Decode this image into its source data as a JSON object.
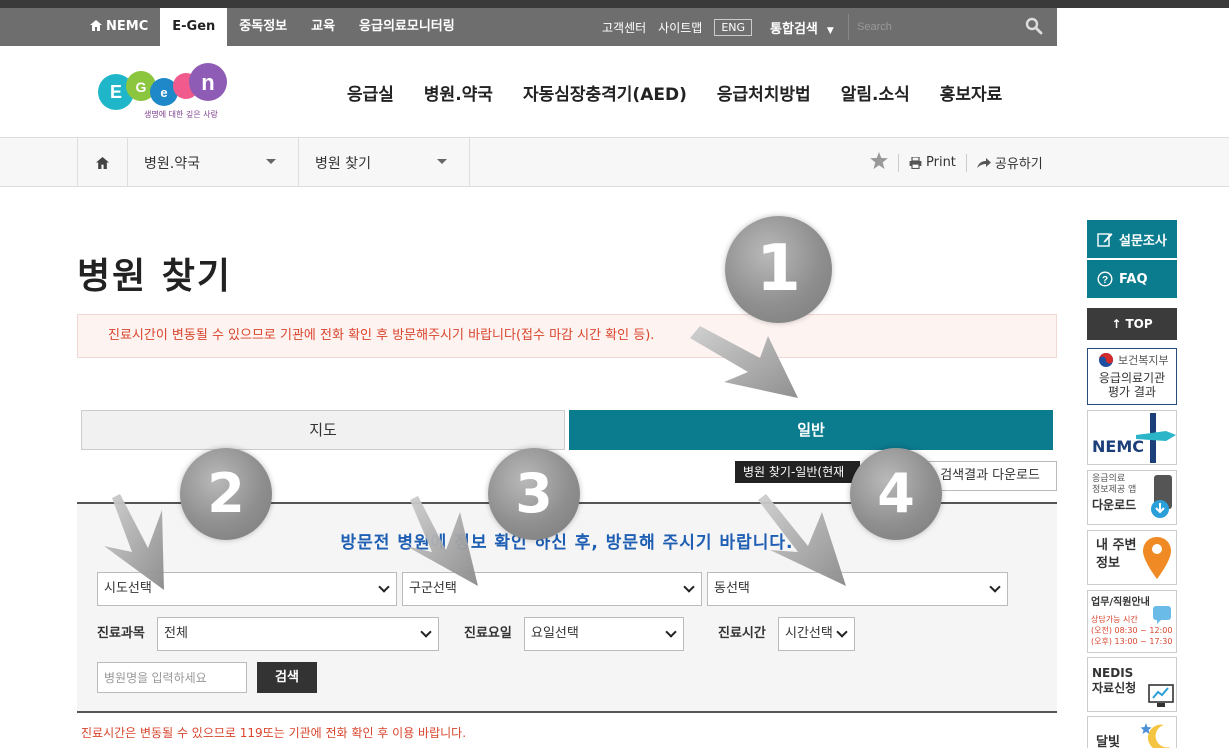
{
  "topnav": {
    "items": [
      {
        "label": "NEMC",
        "active": false
      },
      {
        "label": "E-Gen",
        "active": true
      },
      {
        "label": "중독정보",
        "active": false
      },
      {
        "label": "교육",
        "active": false
      },
      {
        "label": "응급의료모니터링",
        "active": false
      }
    ]
  },
  "toputil": {
    "customer_center": "고객센터",
    "sitemap": "사이트맵",
    "eng": "ENG",
    "total_search": "통합검색",
    "search_placeholder": "Search"
  },
  "logo": {
    "tagline": "생명에 대한 깊은 사랑"
  },
  "mainnav": {
    "items": [
      "응급실",
      "병원.약국",
      "자동심장충격기(AED)",
      "응급처치방법",
      "알림.소식",
      "홍보자료"
    ]
  },
  "breadcrumb": {
    "level1": "병원.약국",
    "level2": "병원 찾기",
    "print": "Print",
    "share": "공유하기"
  },
  "page": {
    "title": "병원 찾기",
    "notice": "진료시간이 변동될 수 있으므로 기관에 전화 확인 후 방문해주시기 바랍니다(접수 마감 시간 확인 등).",
    "tab_map": "지도",
    "tab_general": "일반",
    "tooltip": "병원 찾기-일반(현재",
    "download": "검색결과 다운로드",
    "bottom_note": "진료시간은 변동될 수 있으므로 119또는 기관에 전화 확인 후 이용 바랍니다."
  },
  "search": {
    "title": "방문전 병원에 정보 확인 하신 후, 방문해 주시기 바랍니다.",
    "sido": "시도선택",
    "gugun": "구군선택",
    "dong": "동선택",
    "dept_label": "진료과목",
    "dept_value": "전체",
    "day_label": "진료요일",
    "day_value": "요일선택",
    "time_label": "진료시간",
    "time_value": "시간선택",
    "name_placeholder": "병원명을 입력하세요",
    "search_button": "검색"
  },
  "quickbar": {
    "survey": "설문조사",
    "faq": "FAQ",
    "top": "TOP",
    "mohw": "보건복지부",
    "eval_line1": "응급의료기관",
    "eval_line2": "평가 결과",
    "nemc": "NEMC",
    "app_line1": "응급의료",
    "app_line2": "정보제공 앱",
    "app_line3": "다운로드",
    "near_line1": "내 주변",
    "near_line2": "정보",
    "staff_title": "업무/직원안내",
    "staff_sub": "상담가능 시간",
    "staff_am": "(오전) 08:30 ~ 12:00",
    "staff_pm": "(오후) 13:00 ~ 17:30",
    "nedis_line1": "NEDIS",
    "nedis_line2": "자료신청",
    "moon": "달빛"
  },
  "steps": [
    "1",
    "2",
    "3",
    "4"
  ],
  "colors": {
    "teal": "#0b7b8e",
    "notice_red": "#d9452d",
    "title_blue": "#1e5fb4",
    "topbar_gray": "#6e6e6e"
  }
}
